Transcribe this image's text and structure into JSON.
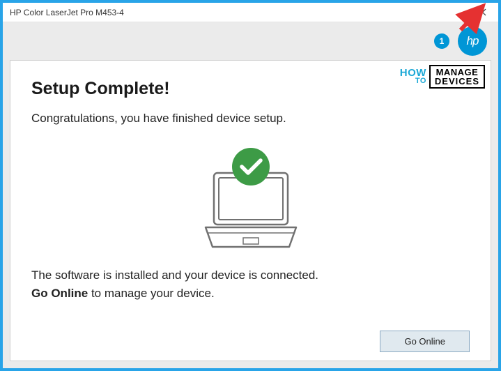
{
  "window": {
    "title": "HP Color LaserJet Pro M453-4"
  },
  "header": {
    "step_number": "1",
    "logo_text": "hp"
  },
  "watermark": {
    "how": "HOW",
    "to": "TO",
    "manage": "MANAGE",
    "devices": "DEVICES"
  },
  "main": {
    "heading": "Setup Complete!",
    "subheading": "Congratulations, you have finished device setup.",
    "status_line1": "The software is installed and your device is connected.",
    "status_bold": "Go Online",
    "status_line2_rest": " to manage your device."
  },
  "footer": {
    "go_online_label": "Go Online"
  }
}
